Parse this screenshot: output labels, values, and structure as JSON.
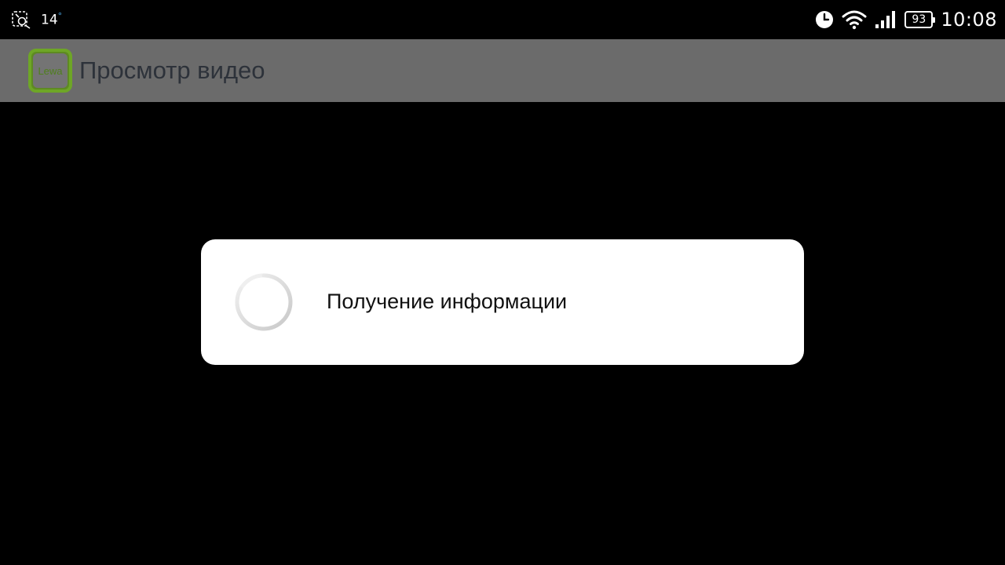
{
  "status_bar": {
    "left_icons": [
      "weather-icon"
    ],
    "temperature": "14",
    "temperature_unit": "°",
    "right_icons": [
      "alarm-clock-icon",
      "wifi-icon",
      "signal-icon",
      "battery-icon"
    ],
    "battery_level": "93",
    "time": "10:08"
  },
  "action_bar": {
    "logo_text": "Lewa",
    "title": "Просмотр видео",
    "background_color": "#6b6b6b"
  },
  "dialog": {
    "message": "Получение информации",
    "indicator": "progress-spinner"
  },
  "colors": {
    "logo_green": "#6ea626",
    "dialog_background": "#ffffff",
    "screen_background": "#000000"
  }
}
